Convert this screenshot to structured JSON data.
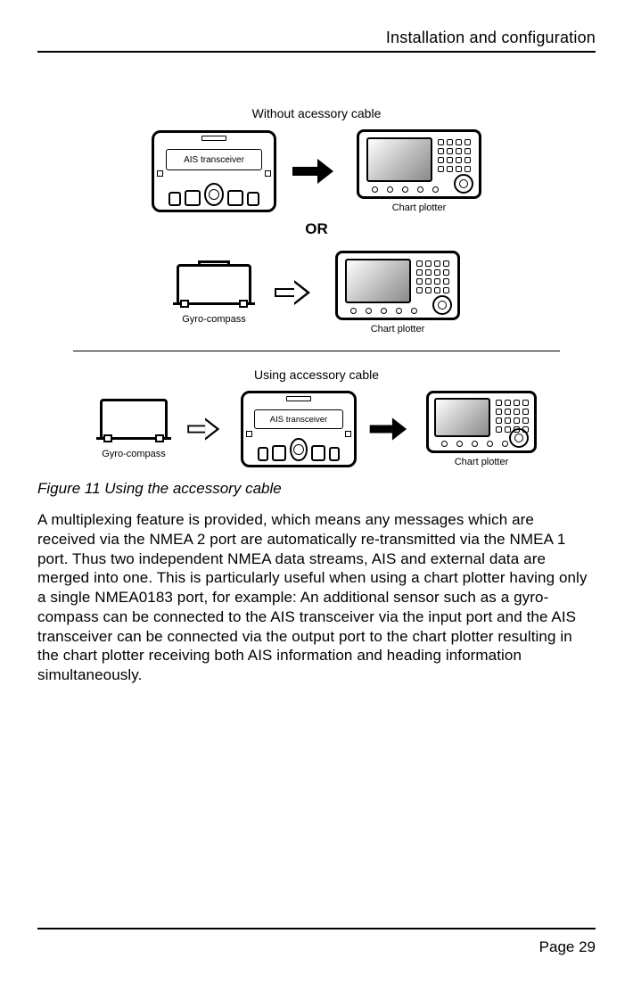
{
  "header": {
    "title": "Installation and configuration"
  },
  "diagram": {
    "section1_title": "Without acessory cable",
    "or_label": "OR",
    "section2_title": "Using accessory cable",
    "labels": {
      "ais": "AIS transceiver",
      "plotter": "Chart plotter",
      "gyro": "Gyro-compass"
    }
  },
  "figure_caption": "Figure 11   Using the accessory cable",
  "body_paragraph": "A multiplexing feature is provided, which means any messages which are received via the NMEA 2 port are automatically re-transmitted via the NMEA 1 port. Thus two independent NMEA data streams, AIS and external data are merged into one. This is particularly useful when using a chart plotter having only a single NMEA0183 port, for example: An additional sensor such as a gyro-compass can be connected to the AIS transceiver via the input port and the AIS transceiver can be connected via the output port to the chart plotter resulting in the chart plotter receiving both AIS information and heading information simultaneously.",
  "footer": {
    "page_label": "Page  29"
  }
}
